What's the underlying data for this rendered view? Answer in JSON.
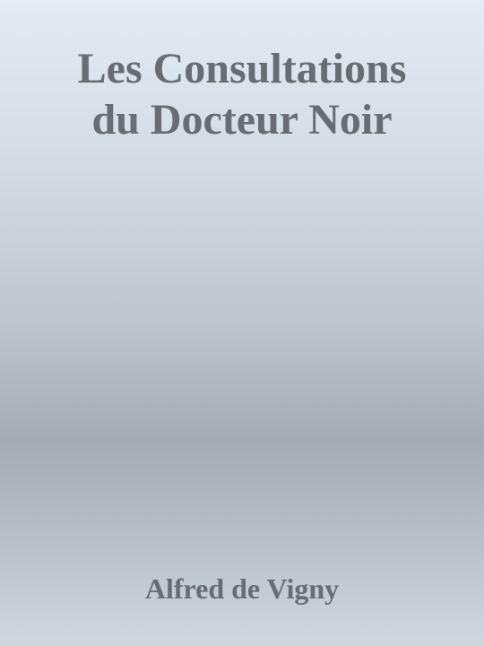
{
  "cover": {
    "title_line1": "Les Consultations",
    "title_line2": "du Docteur Noir",
    "author": "Alfred de Vigny",
    "colors": {
      "text": "#676d70",
      "gradient_top": "#e3ecf2",
      "gradient_mid": "#a3acb0",
      "gradient_bottom": "#cfd8de"
    }
  }
}
